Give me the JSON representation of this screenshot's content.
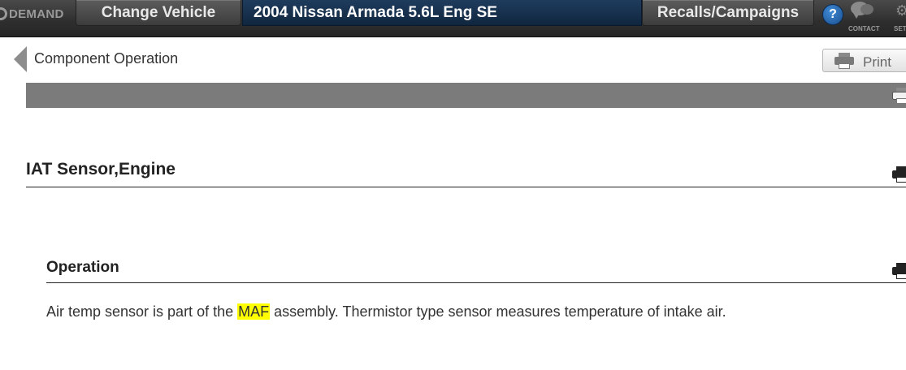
{
  "header": {
    "brand": "DEMAND",
    "change_vehicle": "Change Vehicle",
    "vehicle": "2004 Nissan Armada 5.6L Eng SE",
    "recalls": "Recalls/Campaigns",
    "help": "?",
    "contact_label": "CONTACT",
    "settings_label": "SETTINGS"
  },
  "nav": {
    "breadcrumb": "Component Operation",
    "print_label": "Print"
  },
  "content": {
    "title": "IAT Sensor,Engine",
    "subtitle": "Operation",
    "text_before": "Air temp sensor is part of the ",
    "highlight": "MAF",
    "text_after": " assembly. Thermistor type sensor measures temperature of intake air."
  },
  "icons": {
    "help": "help-icon",
    "contact": "contact-chat-icon",
    "settings": "gear-icon",
    "print": "printer-icon",
    "back": "back-arrow-icon"
  },
  "colors": {
    "header_bg": "#2e2e2e",
    "vehicle_bg": "#1a3453",
    "highlight": "#ffff00",
    "section_bar": "#7b7b7b"
  }
}
